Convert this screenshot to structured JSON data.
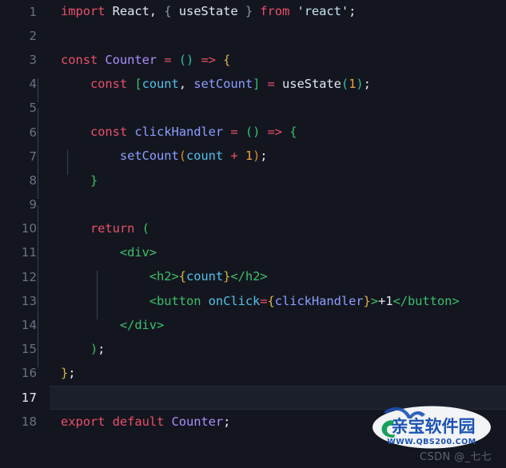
{
  "editor": {
    "theme_background": "#14161f",
    "active_line_background": "#1b1f2b",
    "gutter_color": "#6a7182",
    "active_line_number": 17,
    "total_lines": 18,
    "language": "jsx",
    "line_numbers": [
      "1",
      "2",
      "3",
      "4",
      "5",
      "6",
      "7",
      "8",
      "9",
      "10",
      "11",
      "12",
      "13",
      "14",
      "15",
      "16",
      "17",
      "18"
    ],
    "code_plain": [
      "import React, { useState } from 'react';",
      "",
      "const Counter = () => {",
      "    const [count, setCount] = useState(1);",
      "",
      "    const clickHandler = () => {",
      "        setCount(count + 1);",
      "    }",
      "",
      "    return (",
      "        <div>",
      "            <h2>{count}</h2>",
      "            <button onClick={clickHandler}>+1</button>",
      "        </div>",
      "    );",
      "};",
      "",
      "export default Counter;"
    ]
  },
  "watermark": {
    "brand_text": "亲宝软件园",
    "brand_url": "WWW.QBS200.COM",
    "credit": "CSDN @_七七",
    "brand_color": "#1b52b5",
    "accent_color": "#17a05a"
  }
}
